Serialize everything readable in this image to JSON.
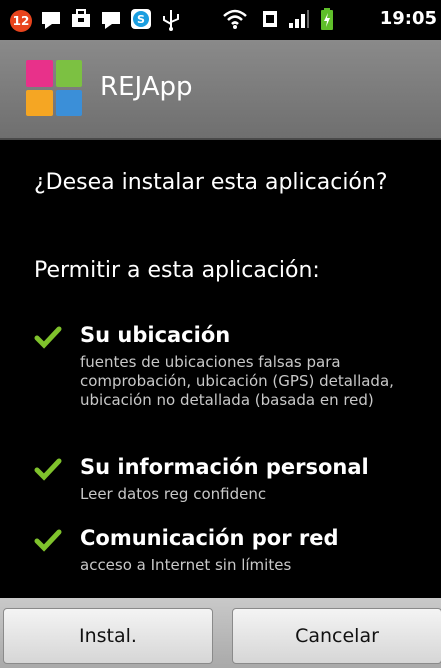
{
  "status_bar": {
    "notification_count": "12",
    "time": "19:05",
    "icons": [
      "notification-badge",
      "message-icon",
      "briefcase-icon",
      "message-icon",
      "skype-icon",
      "usb-icon",
      "wifi-icon",
      "sim-icon",
      "signal-icon",
      "battery-icon"
    ]
  },
  "title_bar": {
    "app_name": "REJApp",
    "logo_colors": [
      "#e8318a",
      "#7cc142",
      "#f5a623",
      "#3b8fd8"
    ]
  },
  "install": {
    "question": "¿Desea instalar esta aplicación?",
    "permit_label": "Permitir a esta aplicación:",
    "permissions": [
      {
        "title": "Su ubicación",
        "description": "fuentes de ubicaciones falsas para comprobación, ubicación (GPS) detallada, ubicación no detallada (basada en red)"
      },
      {
        "title": "Su información personal",
        "description": "Leer datos reg confidenc"
      },
      {
        "title": "Comunicación por red",
        "description": "acceso a Internet sin límites"
      }
    ]
  },
  "buttons": {
    "install": "Instal.",
    "cancel": "Cancelar"
  },
  "colors": {
    "check": "#7fc22c",
    "background": "#000000"
  }
}
